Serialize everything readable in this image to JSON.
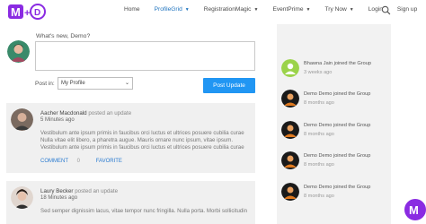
{
  "header": {
    "logo_text": "M+D",
    "nav": [
      {
        "label": "Home",
        "active": false,
        "dropdown": false
      },
      {
        "label": "ProfileGrid",
        "active": true,
        "dropdown": true
      },
      {
        "label": "RegistrationMagic",
        "active": false,
        "dropdown": true
      },
      {
        "label": "EventPrime",
        "active": false,
        "dropdown": true
      },
      {
        "label": "Try Now",
        "active": false,
        "dropdown": true
      },
      {
        "label": "Login",
        "active": false,
        "dropdown": false
      },
      {
        "label": "Sign up",
        "active": false,
        "dropdown": false
      }
    ],
    "search_icon": "search-icon"
  },
  "composer": {
    "prompt": "What's new, Demo?",
    "textarea_value": "",
    "post_in_label": "Post in:",
    "post_in_selected": "My Profile",
    "submit_label": "Post Update"
  },
  "activities": [
    {
      "user": "Aacher Macdonald",
      "action": "posted an update",
      "time": "5 Minutes ago",
      "body": "Vestibulum ante ipsum primis in faucibus orci luctus et ultrices posuere cubilia curae Nulla vitae elit libero, a pharetra augue. Mauris ornare nunc ipsum, vitae ipsum. Vestibulum ante ipsum primis in faucibus orci luctus et ultrices posuere cubilia curae",
      "actions": [
        "COMMENT",
        "FAVORITE"
      ],
      "comment_count": "0"
    },
    {
      "user": "Laury Becker",
      "action": "posted an update",
      "time": "18 Minutes ago",
      "body": "Sed semper dignissim lacus, vitae tempor nunc fringilla. Nulla porta. Morbi sollicitudin"
    }
  ],
  "feed": [
    {
      "text": "Bhawna Jain joined the Group",
      "time": "3 weeks ago",
      "avatar": "default-user-icon"
    },
    {
      "text": "Demo Demo joined the Group",
      "time": "8 months ago",
      "avatar": "user-photo"
    },
    {
      "text": "Demo Demo joined the Group",
      "time": "8 months ago",
      "avatar": "user-photo"
    },
    {
      "text": "Demo Demo joined the Group",
      "time": "8 months ago",
      "avatar": "user-photo"
    },
    {
      "text": "Demo Demo joined the Group",
      "time": "8 months ago",
      "avatar": "user-photo"
    }
  ],
  "colors": {
    "accent": "#2196f3",
    "active_nav": "#1e73be",
    "logo_purple": "#8a2be2",
    "sidebar_bg": "#f2f2f2",
    "card_bg": "#f0f0f0"
  }
}
